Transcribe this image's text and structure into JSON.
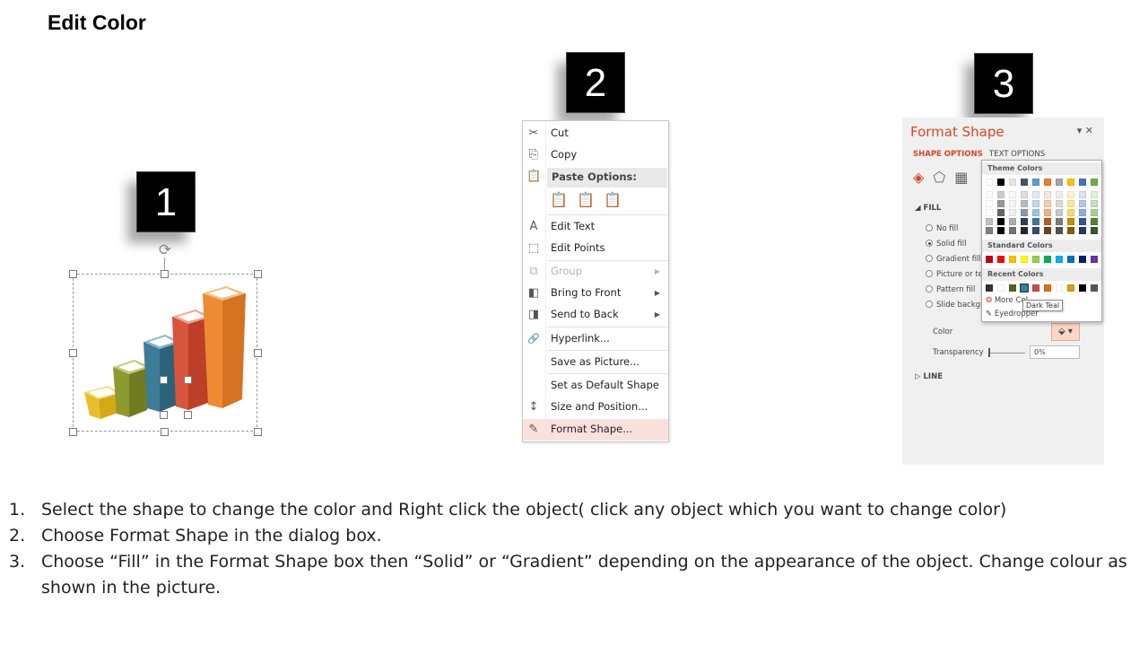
{
  "title": "Edit Color",
  "steps": [
    "1",
    "2",
    "3"
  ],
  "context_menu": {
    "items": [
      {
        "label": "Cut",
        "icon": "scissors-icon",
        "glyph": "✂"
      },
      {
        "label": "Copy",
        "icon": "copy-icon",
        "glyph": "⎘"
      },
      {
        "label": "Edit Text",
        "icon": "edit-text-icon",
        "glyph": "A"
      },
      {
        "label": "Edit Points",
        "icon": "edit-points-icon",
        "glyph": "⬚"
      },
      {
        "label": "Group",
        "icon": "group-icon",
        "glyph": "⧉",
        "disabled": true,
        "submenu": true
      },
      {
        "label": "Bring to Front",
        "icon": "bring-to-front-icon",
        "glyph": "◧",
        "submenu": true
      },
      {
        "label": "Send to Back",
        "icon": "send-to-back-icon",
        "glyph": "◨",
        "submenu": true
      },
      {
        "label": "Hyperlink...",
        "icon": "hyperlink-icon",
        "glyph": "🔗"
      },
      {
        "label": "Save as Picture...",
        "icon": "",
        "glyph": ""
      },
      {
        "label": "Set as Default Shape",
        "icon": "",
        "glyph": ""
      },
      {
        "label": "Size and Position...",
        "icon": "size-position-icon",
        "glyph": "↕"
      },
      {
        "label": "Format Shape...",
        "icon": "format-shape-icon",
        "glyph": "✎",
        "highlight": true
      }
    ],
    "paste_header": "Paste Options:",
    "paste_icon": "clipboard-icon"
  },
  "format_pane": {
    "title": "Format Shape",
    "close": "▾ ✕",
    "tabs": [
      "SHAPE OPTIONS",
      "TEXT OPTIONS"
    ],
    "fill_section": "FILL",
    "fill_options": [
      "No fill",
      "Solid fill",
      "Gradient fill",
      "Picture or te",
      "Pattern fill",
      "Slide backgr"
    ],
    "selected_fill": "Solid fill",
    "color_label": "Color",
    "color_button": "⬙ ▾",
    "transparency_label": "Transparency",
    "transparency_value": "0%",
    "line_section": "LINE"
  },
  "palette": {
    "theme_header": "Theme Colors",
    "standard_header": "Standard Colors",
    "recent_header": "Recent Colors",
    "theme_top": [
      "#ffffff",
      "#000000",
      "#e7e6e6",
      "#44546a",
      "#5b9bd5",
      "#ed7d31",
      "#a5a5a5",
      "#ffc000",
      "#4472c4",
      "#70ad47"
    ],
    "standard": [
      "#c00000",
      "#ff0000",
      "#ffc000",
      "#ffff00",
      "#92d050",
      "#00b050",
      "#00b0f0",
      "#0070c0",
      "#002060",
      "#7030a0"
    ],
    "recent": [
      "#333333",
      "#ffffff",
      "#4f6228",
      "#31859c",
      "#c0504d",
      "#e46c0a",
      "#ffffff",
      "#d4a017",
      "#000000",
      "#595959"
    ],
    "more_colors": "More Col",
    "eyedropper": "Eyedropper",
    "tooltip": "Dark Teal"
  },
  "instructions": [
    {
      "num": "1.",
      "text": "Select the shape to change the color and Right click the object( click any object which you want to change color)"
    },
    {
      "num": "2.",
      "text": "Choose Format Shape in the dialog box."
    },
    {
      "num": "3.",
      "text": "Choose “Fill” in the Format Shape box then “Solid” or “Gradient” depending on the appearance of the object. Change colour as shown in the picture."
    }
  ]
}
